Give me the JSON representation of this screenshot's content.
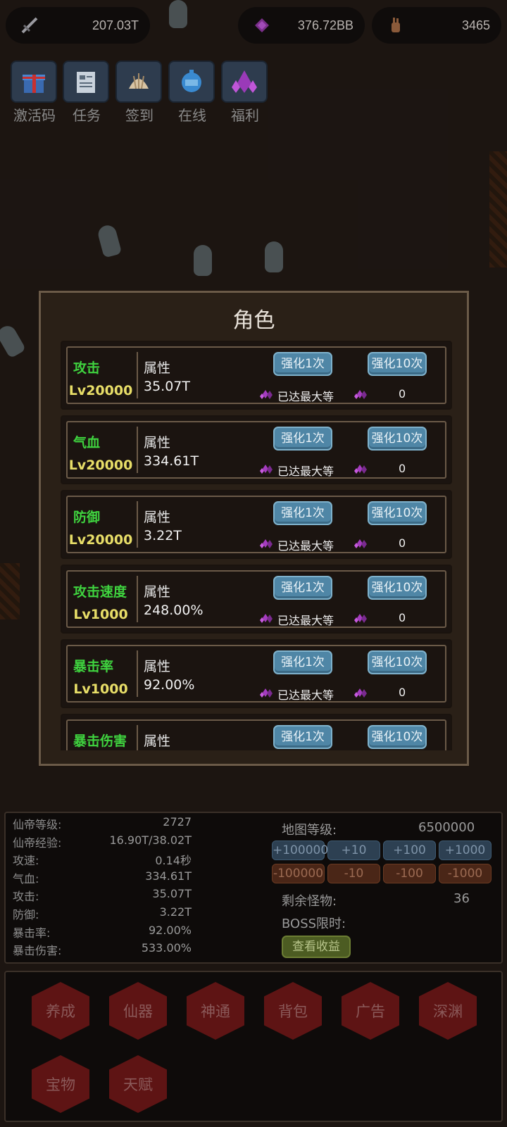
{
  "top_bar": {
    "sword": {
      "icon": "sword-icon",
      "value": "207.03T"
    },
    "gems": {
      "icon": "gem-icon",
      "value": "376.72BB"
    },
    "hand": {
      "icon": "hand-icon",
      "value": "3465"
    }
  },
  "quick_icons": [
    {
      "label": "激活码",
      "icon": "gift-icon"
    },
    {
      "label": "任务",
      "icon": "task-icon"
    },
    {
      "label": "签到",
      "icon": "shell-icon"
    },
    {
      "label": "在线",
      "icon": "clock-icon"
    },
    {
      "label": "福利",
      "icon": "crystal-icon"
    }
  ],
  "modal": {
    "title": "角色",
    "attr_label": "属性",
    "btn_once": "强化1次",
    "btn_ten": "强化10次",
    "max_text": "已达最大等",
    "rows": [
      {
        "name": "攻击",
        "level": "Lv20000",
        "value": "35.07T",
        "cost10": "0"
      },
      {
        "name": "气血",
        "level": "Lv20000",
        "value": "334.61T",
        "cost10": "0"
      },
      {
        "name": "防御",
        "level": "Lv20000",
        "value": "3.22T",
        "cost10": "0"
      },
      {
        "name": "攻击速度",
        "level": "Lv1000",
        "value": "248.00%",
        "cost10": "0"
      },
      {
        "name": "暴击率",
        "level": "Lv1000",
        "value": "92.00%",
        "cost10": "0"
      },
      {
        "name": "暴击伤害",
        "level": "",
        "value": "",
        "cost10": ""
      }
    ]
  },
  "stats": {
    "items": [
      {
        "label": "仙帝等级:",
        "value": "2727"
      },
      {
        "label": "仙帝经验:",
        "value": "16.90T/38.02T"
      },
      {
        "label": "攻速:",
        "value": "0.14秒"
      },
      {
        "label": "气血:",
        "value": "334.61T"
      },
      {
        "label": "攻击:",
        "value": "35.07T"
      },
      {
        "label": "防御:",
        "value": "3.22T"
      },
      {
        "label": "暴击率:",
        "value": "92.00%"
      },
      {
        "label": "暴击伤害:",
        "value": "533.00%"
      }
    ],
    "map_level_label": "地图等级:",
    "map_level_value": "6500000",
    "plus_buttons": [
      "+100000",
      "+10",
      "+100",
      "+1000"
    ],
    "minus_buttons": [
      "-100000",
      "-10",
      "-100",
      "-1000"
    ],
    "remaining_label": "剩余怪物:",
    "remaining_value": "36",
    "boss_label": "BOSS限时:",
    "earnings_button": "查看收益"
  },
  "menu": [
    "养成",
    "仙器",
    "神通",
    "背包",
    "广告",
    "深渊",
    "宝物",
    "天赋"
  ],
  "colors": {
    "name_green": "#3fd33f",
    "level_yellow": "#e8de68",
    "button_blue": "#4f86a6",
    "hex_red": "#5e1414"
  }
}
